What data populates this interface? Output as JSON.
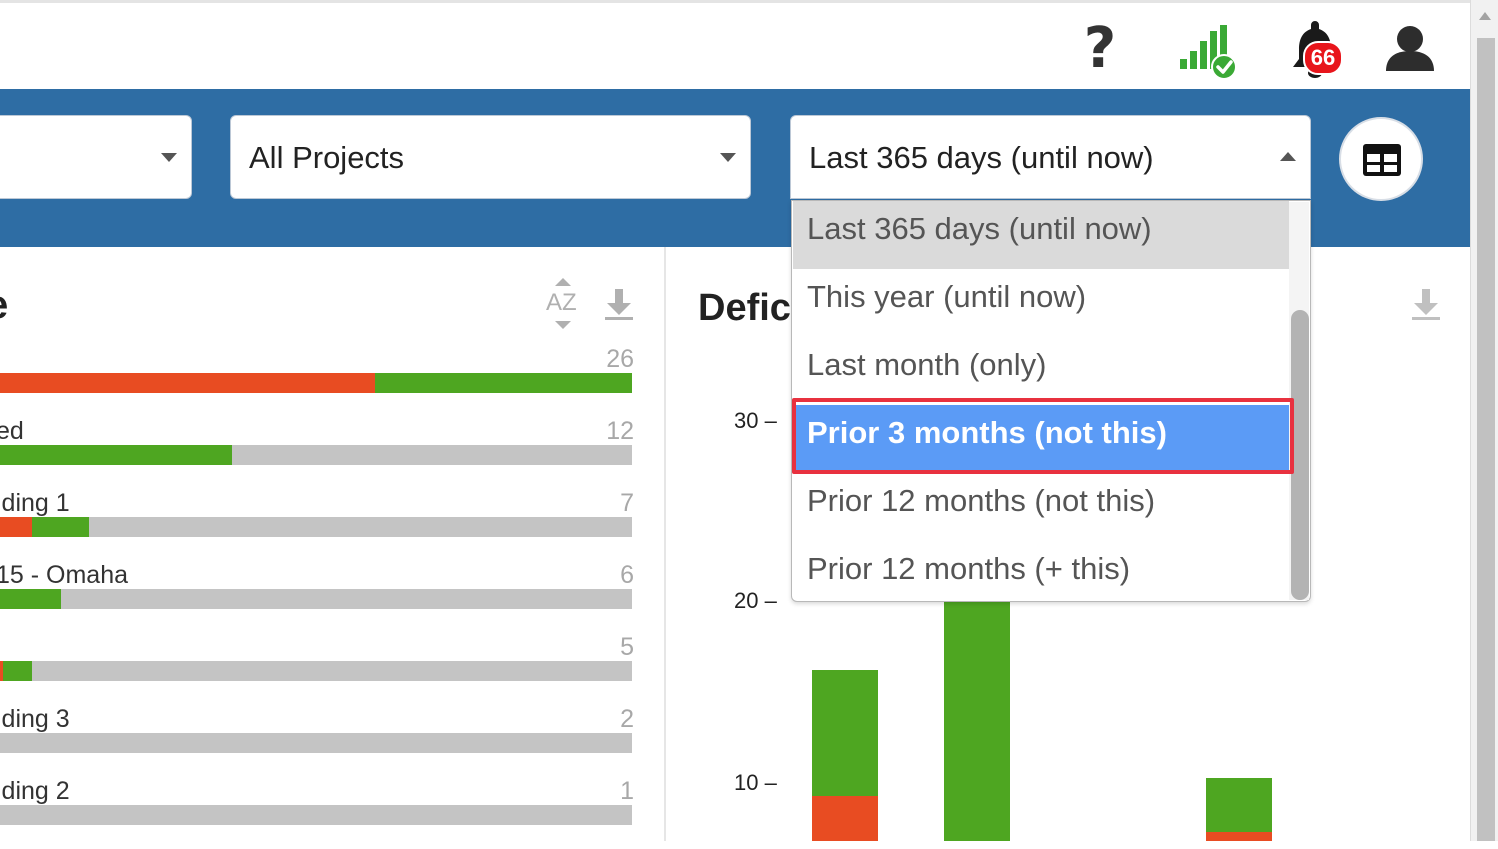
{
  "header": {
    "icons": [
      "help-icon",
      "signal-status-icon",
      "bell-icon",
      "user-icon"
    ],
    "notification_count": "66"
  },
  "filters": {
    "left_select_value": "",
    "projects_select_value": "All Projects",
    "date_range_value": "Last 365 days (until now)",
    "date_range_options": [
      "Last 365 days (until now)",
      "This year (until now)",
      "Last month (only)",
      "Prior 3 months (not this)",
      "Prior 12 months (not this)",
      "Prior 12 months (+ this)"
    ],
    "highlighted_option": "Prior 3 months (not this)"
  },
  "left_panel": {
    "title": "e",
    "sort_label": "AZ",
    "rows": [
      {
        "label": "",
        "count": "26",
        "red": 0.594,
        "green": 0.406
      },
      {
        "label": "ed",
        "count": "12",
        "red": 0.0,
        "green": 0.367
      },
      {
        "label": "lding 1",
        "count": "7",
        "red": 0.051,
        "green": 0.09
      },
      {
        "label": "15 - Omaha",
        "count": "6",
        "red": 0.0,
        "green": 0.097
      },
      {
        "label": "",
        "count": "5",
        "red": 0.005,
        "green": 0.046
      },
      {
        "label": "lding 3",
        "count": "2",
        "red": 0.0,
        "green": 0.0
      },
      {
        "label": "lding 2",
        "count": "1",
        "red": 0.0,
        "green": 0.0
      }
    ]
  },
  "right_panel": {
    "title": "Defic",
    "y_ticks": [
      "30 –",
      "20 –",
      "10 –"
    ]
  },
  "chart_data": {
    "type": "bar",
    "stacked": true,
    "ylim": [
      0,
      33
    ],
    "y_ticks": [
      10,
      20,
      30
    ],
    "series": [
      {
        "color": "#e84c22",
        "values": [
          2.1,
          0.0,
          1.1,
          0.0
        ]
      },
      {
        "color": "#4ea621",
        "values": [
          7.0,
          22.2,
          3.0,
          0.2
        ]
      }
    ],
    "visible_tops": [
      16.1,
      22.2,
      10.1,
      0.2
    ]
  },
  "colors": {
    "filter_band": "#2e6da4",
    "red": "#e84c22",
    "green": "#4ea621",
    "hover_option": "#5b9bf6",
    "highlight_border": "#e8313f",
    "badge": "#e8151b"
  }
}
